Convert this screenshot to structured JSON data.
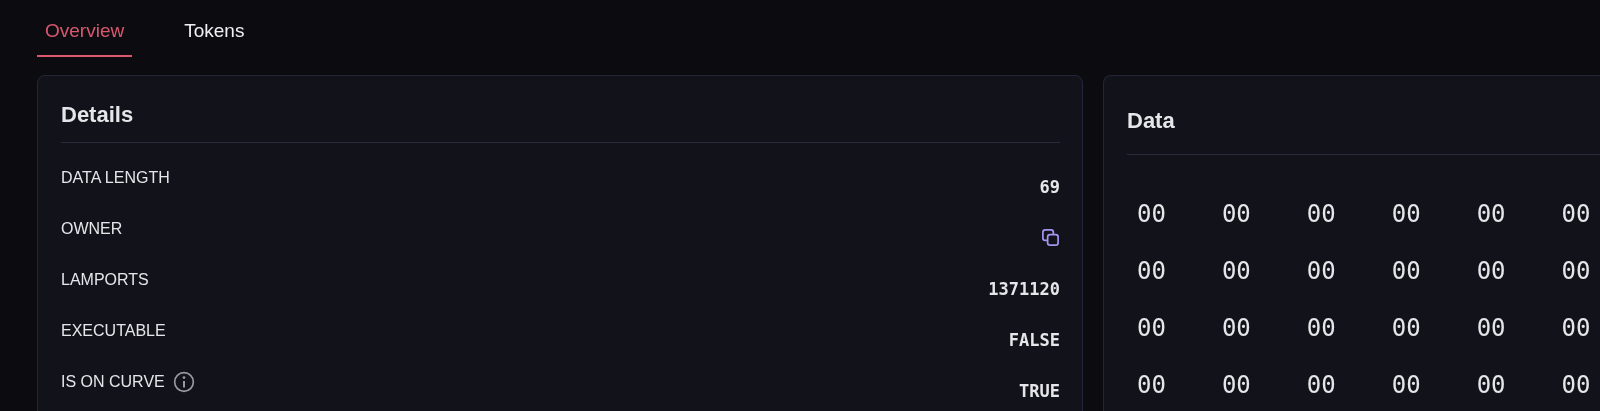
{
  "tabs": [
    {
      "label": "Overview",
      "selected": true
    },
    {
      "label": "Tokens",
      "selected": false
    }
  ],
  "details": {
    "title": "Details",
    "rows": [
      {
        "label": "DATA LENGTH",
        "kind": "text",
        "value": "69",
        "info": false
      },
      {
        "label": "OWNER",
        "kind": "copy",
        "info": false
      },
      {
        "label": "LAMPORTS",
        "kind": "text",
        "value": "1371120",
        "info": false
      },
      {
        "label": "EXECUTABLE",
        "kind": "text",
        "value": "FALSE",
        "info": false
      },
      {
        "label": "IS ON CURVE",
        "kind": "text",
        "value": "TRUE",
        "info": true
      }
    ]
  },
  "data": {
    "title": "Data",
    "rows": [
      [
        "00",
        "00",
        "00",
        "00",
        "00",
        "00"
      ],
      [
        "00",
        "00",
        "00",
        "00",
        "00",
        "00"
      ],
      [
        "00",
        "00",
        "00",
        "00",
        "00",
        "00"
      ],
      [
        "00",
        "00",
        "00",
        "00",
        "00",
        "00"
      ]
    ]
  }
}
